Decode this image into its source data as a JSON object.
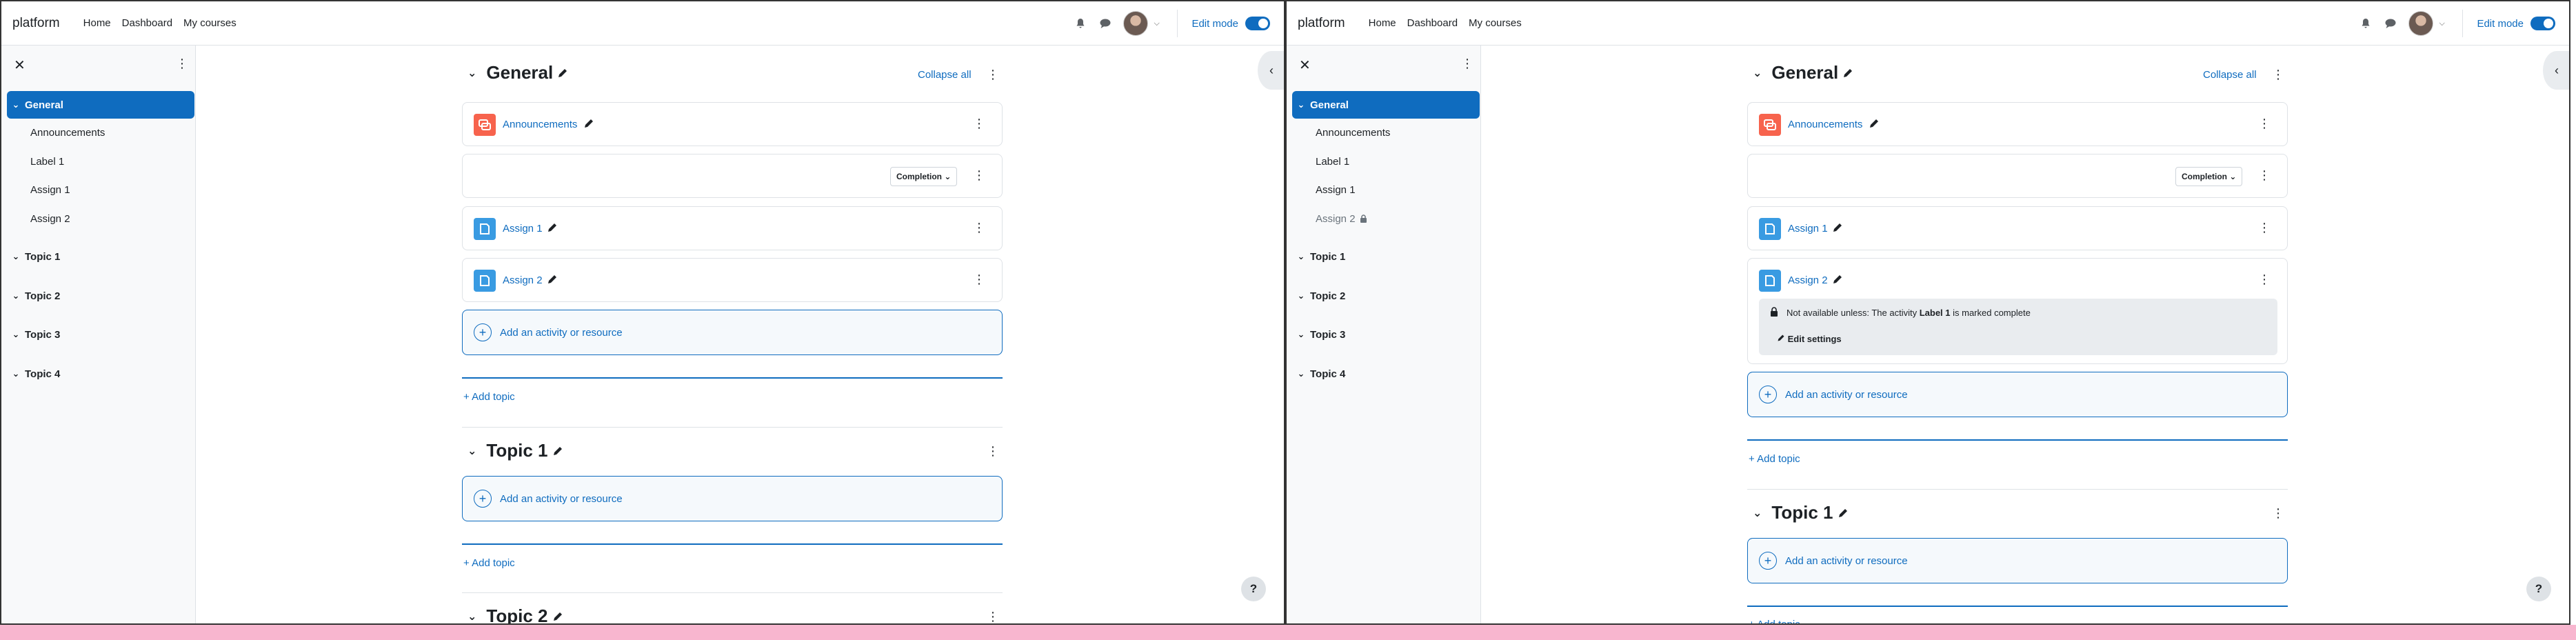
{
  "navbar": {
    "brand": "platform",
    "links": [
      "Home",
      "Dashboard",
      "My courses"
    ],
    "edit_mode_label": "Edit mode",
    "icons": [
      "bell-icon",
      "chat-icon",
      "avatar",
      "chevron-down-icon"
    ]
  },
  "drawer": {
    "sections": [
      {
        "label": "General",
        "items": [
          "Announcements",
          "Label 1",
          "Assign 1",
          "Assign 2"
        ]
      },
      {
        "label": "Topic 1"
      },
      {
        "label": "Topic 2"
      },
      {
        "label": "Topic 3"
      },
      {
        "label": "Topic 4"
      }
    ]
  },
  "course": {
    "general_title": "General",
    "collapse_all": "Collapse all",
    "completion_label": "Completion",
    "activities": {
      "announcements": "Announcements",
      "assign1": "Assign 1",
      "assign2": "Assign 2"
    },
    "add_activity": "Add an activity or resource",
    "add_topic": "Add topic",
    "topic1_title": "Topic 1",
    "topic2_title": "Topic 2",
    "restriction": {
      "prefix": "Not available unless: The activity ",
      "activity": "Label 1",
      "suffix": " is marked complete",
      "edit_settings": "Edit settings"
    }
  },
  "help_label": "?",
  "colors": {
    "primary": "#0f6cbf",
    "forum": "#f7634d",
    "assign": "#399be2",
    "drawer_bg": "#f8f9fa",
    "bottom_bar": "#f8b6cf"
  }
}
